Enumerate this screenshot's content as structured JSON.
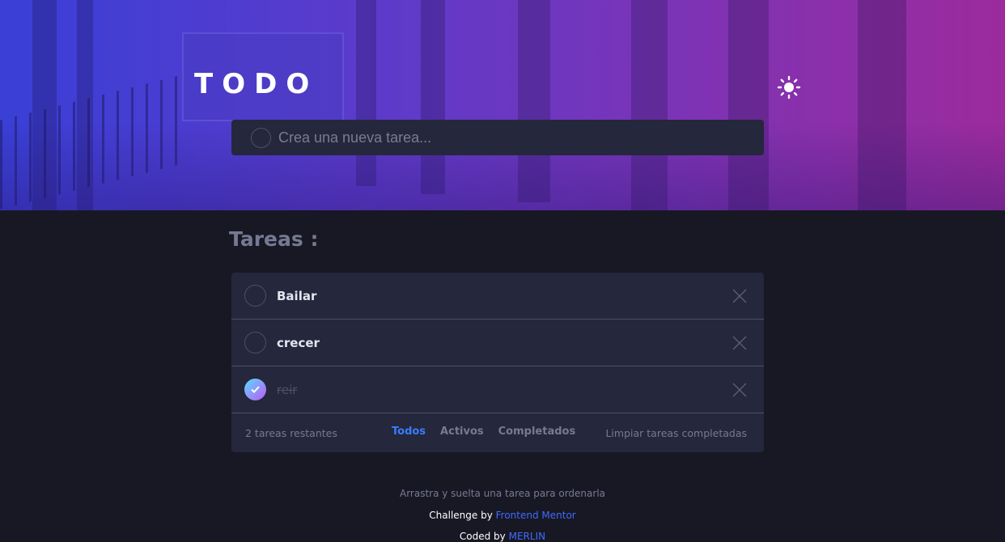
{
  "header": {
    "logo": "TODO",
    "theme_icon": "sun-icon",
    "new_task_placeholder": "Crea una nueva tarea..."
  },
  "section_title": "Tareas :",
  "tasks": [
    {
      "label": "Bailar",
      "completed": false
    },
    {
      "label": "crecer",
      "completed": false
    },
    {
      "label": "reir",
      "completed": true
    }
  ],
  "footer": {
    "remaining": "2 tareas restantes",
    "filters": [
      "Todos",
      "Activos",
      "Completados"
    ],
    "active_filter": "Todos",
    "clear_completed": "Limpiar tareas completadas"
  },
  "hint": "Arrastra y suelta una tarea para ordenarla",
  "attribution": {
    "challenge_prefix": "Challenge by",
    "challenge_link": "Frontend Mentor",
    "coded_prefix": "Coded by",
    "coded_link": "MERLIN"
  },
  "colors": {
    "accent": "#3a7cfd",
    "card": "#25273c",
    "background": "#181824"
  }
}
